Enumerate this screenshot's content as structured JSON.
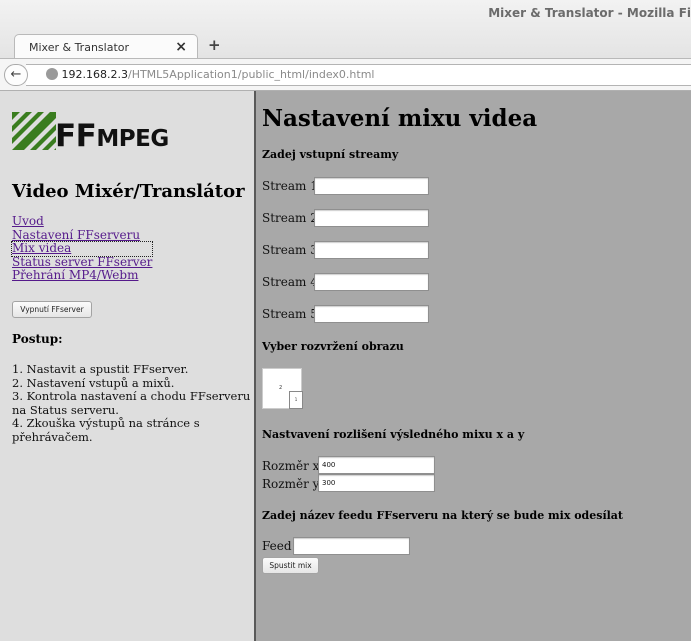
{
  "browser": {
    "window_title": "Mixer & Translator - Mozilla Fi",
    "tab_title": "Mixer & Translator",
    "tab_close": "×",
    "new_tab": "+",
    "back": "←",
    "url_host": "192.168.2.3",
    "url_path": "/HTML5Application1/public_html/index0.html"
  },
  "sidebar": {
    "logo_ff": "FF",
    "logo_mpeg": "MPEG",
    "title": "Video Mixér/Translátor",
    "nav_links": [
      "Uvod",
      "Nastavení FFserveru",
      "Mix videa",
      "Status server FFserver",
      "Přehrání MP4/Webm"
    ],
    "stop_button": "Vypnutí FFserver",
    "postup_heading": "Postup:",
    "steps": [
      "1. Nastavit a spustit FFserver.",
      "2. Nastavení vstupů a mixů.",
      "3. Kontrola nastavení a chodu FFserveru na Status serveru.",
      "4. Zkouška výstupů na stránce s přehrávačem."
    ]
  },
  "main": {
    "title": "Nastavení mixu videa",
    "streams_heading": "Zadej vstupní streamy",
    "stream_labels": [
      "Stream 1",
      "Stream 2",
      "Stream 3",
      "Stream 4",
      "Stream 5"
    ],
    "stream_values": [
      "",
      "",
      "",
      "",
      ""
    ],
    "layout_heading": "Vyber rozvržení obrazu",
    "layout_preview": {
      "main": "2",
      "small": "1"
    },
    "resolution_heading": "Nastvavení rozlišení výsledného mixu x a y",
    "size_x_label": "Rozměr x",
    "size_x_value": "400",
    "size_y_label": "Rozměr y",
    "size_y_value": "300",
    "feed_heading": "Zadej název feedu FFserveru na který se bude mix odesílat",
    "feed_label": "Feed",
    "feed_value": "",
    "run_button": "Spustit mix"
  }
}
